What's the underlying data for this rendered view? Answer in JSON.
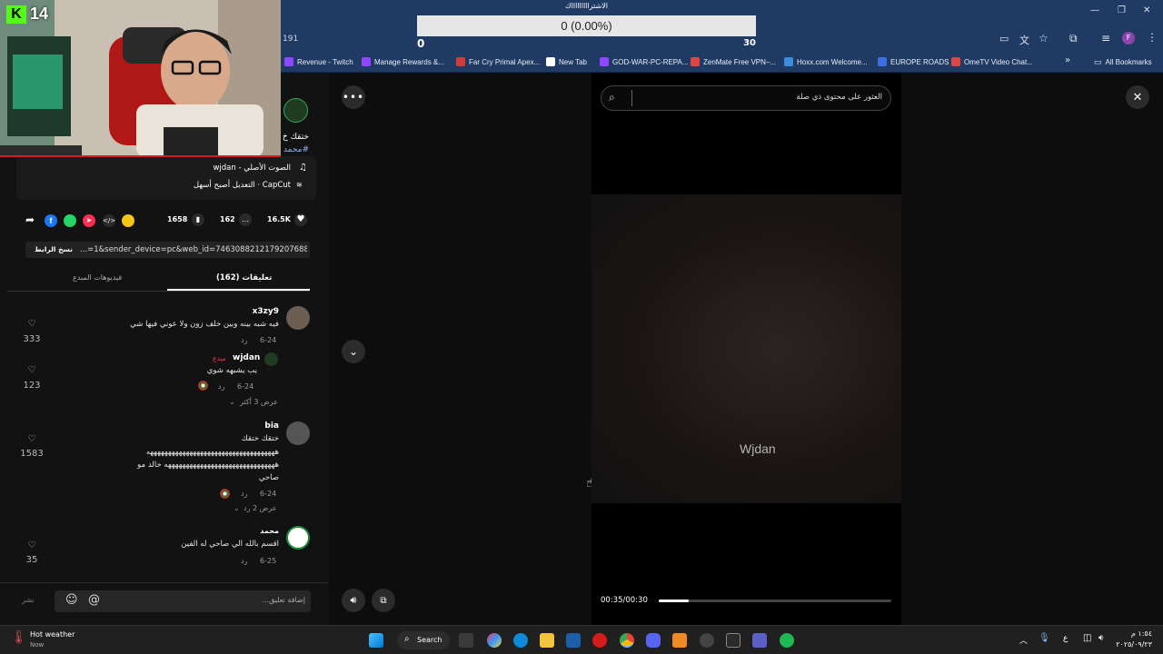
{
  "browser": {
    "tab_count_text": "191",
    "bookmarks": [
      {
        "label": "Revenue - Twitch",
        "color": "#9146ff"
      },
      {
        "label": "Manage Rewards &...",
        "color": "#9146ff"
      },
      {
        "label": "Far Cry Primal Apex...",
        "color": "#d23b3b"
      },
      {
        "label": "New Tab",
        "color": "#ffffff"
      },
      {
        "label": "GOD-WAR-PC-REPA...",
        "color": "#9146ff"
      },
      {
        "label": "ZenMate Free VPN–...",
        "color": "#e04545"
      },
      {
        "label": "Hoxx.com Welcome...",
        "color": "#3b8de0"
      },
      {
        "label": "EUROPE ROADS",
        "color": "#3b6ee0"
      },
      {
        "label": "OmeTV Video Chat...",
        "color": "#e04545"
      }
    ],
    "all_bookmarks": "All Bookmarks",
    "profile_initial": "F"
  },
  "goal": {
    "title": "الاشتراااااااااك",
    "progress_text": "0 (0.00%)",
    "min": "0",
    "max": "30",
    "progress_fraction": 0.0
  },
  "stream_overlay": {
    "platform_letter": "K",
    "viewer_count": "14"
  },
  "post": {
    "caption_line1": "ختقك خ",
    "caption_tag": "#محمد",
    "sound": "الصوت الأصلي - wjdan",
    "capcut": "CapCut · التعديل أصبح أسهل",
    "likes": "16.5K",
    "comments": "162",
    "saves": "1658",
    "link_text": "...=1&sender_device=pc&web_id=7463088212179207688",
    "copy_link": "نسخ الرابط",
    "tab_comments": "تعليقات (162)",
    "tab_creator": "فيديوهات المبدع"
  },
  "comments": [
    {
      "user": "x3zy9",
      "text": "فيه شبه بينه وبين خلف زون ولا عوني فيها شي",
      "date": "6-24",
      "reply": "رد",
      "likes": "333"
    },
    {
      "user": "wjdan",
      "badge": "مبدع",
      "text": "يب يشبهه شوي",
      "date": "6-24",
      "reply": "رد",
      "likes": "123",
      "more": "عرض 3 أكثر"
    },
    {
      "user": "bia",
      "text_line1": "ختقك ختقك",
      "text_line2": "ههههههههههههههههههههههههههههههههههههه",
      "text_line3": "هههههههههههههههههههههههههههههههه خالد مو",
      "text_line4": "صاحي",
      "date": "6-24",
      "reply": "رد",
      "likes": "1583",
      "more": "عرض 2 رد"
    },
    {
      "user": "محمد",
      "text": "اقسم بالله الي صاحي له الفين",
      "date": "6-25",
      "reply": "رد",
      "likes": "35"
    }
  ],
  "comment_input": {
    "placeholder": "إضافة تعليق...",
    "post_label": "نشر"
  },
  "search": {
    "placeholder": "العثور على محتوى ذي صلة"
  },
  "video": {
    "watermark": "Wjdan",
    "time": "00:35/00:30",
    "progress_fraction": 0.13
  },
  "taskbar": {
    "weather_title": "Hot weather",
    "weather_sub": "Now",
    "search_label": "Search",
    "lang": "ع",
    "time": "١:٥٤ م",
    "date": "٢٠٢٥/٠٩/٢٣"
  },
  "colors": {
    "browser_chrome": "#1f3a63",
    "accent_red": "#fe2c55",
    "kick_green": "#53fc18"
  }
}
